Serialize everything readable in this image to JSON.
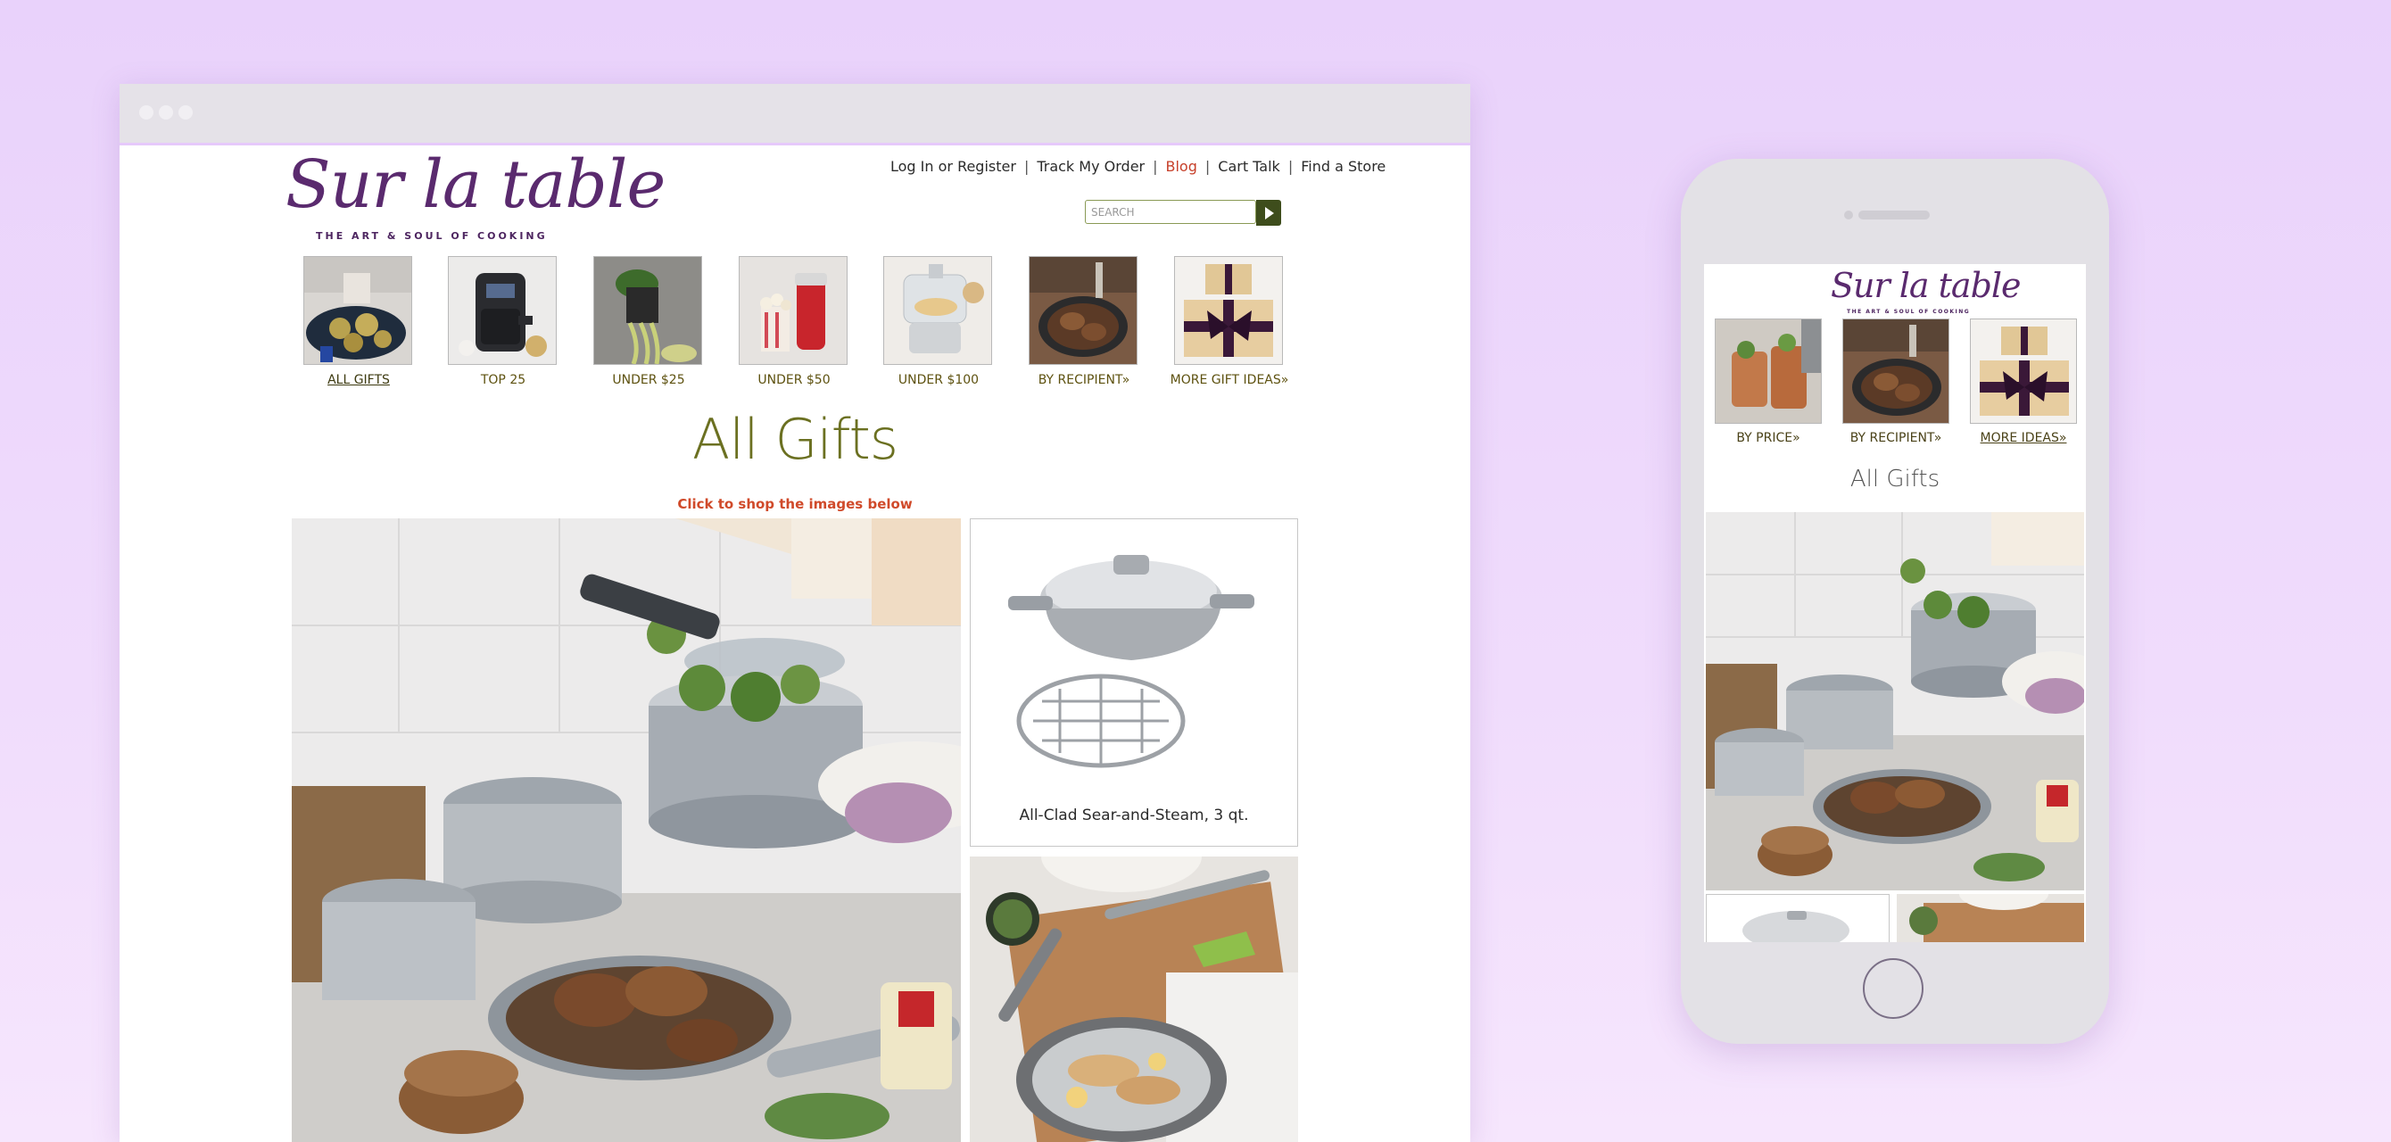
{
  "colors": {
    "background": "#ecd5fb",
    "brand_purple": "#5a2a6e",
    "nav_olive": "#5e5210",
    "title_olive": "#6b7021",
    "accent_red": "#d04a2a",
    "search_btn": "#3e4d1c"
  },
  "desktop": {
    "logo": {
      "text": "Sur la table",
      "tagline": "THE ART & SOUL OF COOKING"
    },
    "utility_nav": [
      "Log In or Register",
      "Track My Order",
      "Blog",
      "Cart Talk",
      "Find a Store"
    ],
    "search": {
      "placeholder": "SEARCH"
    },
    "categories": [
      {
        "label": "ALL GIFTS",
        "icon": "artichoke-platter-image",
        "active": true
      },
      {
        "label": "TOP 25",
        "icon": "air-fryer-image"
      },
      {
        "label": "UNDER $25",
        "icon": "spiralizer-image"
      },
      {
        "label": "UNDER $50",
        "icon": "popcorn-maker-image"
      },
      {
        "label": "UNDER $100",
        "icon": "food-processor-image"
      },
      {
        "label": "BY RECIPIENT»",
        "icon": "skillet-image"
      },
      {
        "label": "MORE GIFT IDEAS»",
        "icon": "gift-box-image"
      }
    ],
    "page_title": "All Gifts",
    "subtitle": "Click to shop the images below",
    "products": [
      {
        "name": "All-Clad Sear-and-Steam, 3 qt."
      }
    ]
  },
  "mobile": {
    "logo": {
      "text": "Sur la table",
      "tagline": "THE ART & SOUL OF COOKING"
    },
    "categories": [
      {
        "label": "BY PRICE»",
        "icon": "copper-mugs-image"
      },
      {
        "label": "BY RECIPIENT»",
        "icon": "skillet-image"
      },
      {
        "label": "MORE IDEAS»",
        "icon": "gift-box-image",
        "active": true
      }
    ],
    "page_title": "All Gifts"
  }
}
